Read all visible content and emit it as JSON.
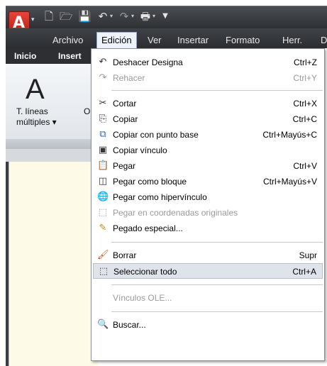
{
  "quick_access": {
    "icons": [
      "new-icon",
      "open-icon",
      "save-icon",
      "undo-icon",
      "redo-icon",
      "print-icon",
      "customize-icon"
    ]
  },
  "menubar": {
    "items": [
      "Archivo",
      "Edición",
      "Ver",
      "Insertar",
      "Formato",
      "Herr.",
      "D"
    ]
  },
  "ribbon": {
    "tabs": [
      "Inicio",
      "Insert"
    ],
    "mtext_glyph": "A",
    "mtext_label_line1": "T. líneas",
    "mtext_label_line2": "múltiples ▾",
    "second_label": "Or"
  },
  "edit_menu": {
    "items": [
      {
        "label": "Deshacer Designa",
        "shortcut": "Ctrl+Z",
        "icon": "undo-icon",
        "enabled": true
      },
      {
        "label": "Rehacer",
        "shortcut": "Ctrl+Y",
        "icon": "redo-icon",
        "enabled": false
      },
      {
        "label": "Cortar",
        "shortcut": "Ctrl+X",
        "icon": "cut-icon",
        "enabled": true
      },
      {
        "label": "Copiar",
        "shortcut": "Ctrl+C",
        "icon": "copy-icon",
        "enabled": true
      },
      {
        "label": "Copiar con punto base",
        "shortcut": "Ctrl+Mayús+C",
        "icon": "copy-base-point-icon",
        "enabled": true
      },
      {
        "label": "Copiar vínculo",
        "shortcut": "",
        "icon": "copy-link-icon",
        "enabled": true
      },
      {
        "label": "Pegar",
        "shortcut": "Ctrl+V",
        "icon": "paste-icon",
        "enabled": true
      },
      {
        "label": "Pegar como bloque",
        "shortcut": "Ctrl+Mayús+V",
        "icon": "paste-block-icon",
        "enabled": true
      },
      {
        "label": "Pegar como hipervínculo",
        "shortcut": "",
        "icon": "paste-hyperlink-icon",
        "enabled": true
      },
      {
        "label": "Pegar en coordenadas originales",
        "shortcut": "",
        "icon": "paste-original-coords-icon",
        "enabled": false
      },
      {
        "label": "Pegado especial...",
        "shortcut": "",
        "icon": "paste-special-icon",
        "enabled": true
      },
      {
        "label": "Borrar",
        "shortcut": "Supr",
        "icon": "erase-icon",
        "enabled": true
      },
      {
        "label": "Seleccionar todo",
        "shortcut": "Ctrl+A",
        "icon": "select-all-icon",
        "enabled": true,
        "highlighted": true
      },
      {
        "label": "Vínculos OLE...",
        "shortcut": "",
        "icon": "",
        "enabled": false
      },
      {
        "label": "Buscar...",
        "shortcut": "",
        "icon": "find-icon",
        "enabled": true
      }
    ]
  },
  "colors": {
    "titlebar": "#2e3034",
    "menu_highlight": "#dfe3ea",
    "canvas": "#fdfbe8",
    "app_button": "#d1312a"
  }
}
